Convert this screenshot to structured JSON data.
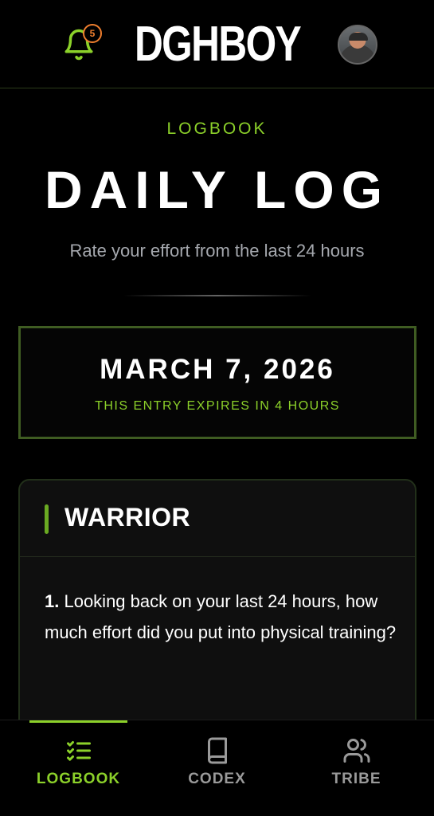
{
  "header": {
    "logo_text": "DGHBOY",
    "notification_count": "5",
    "icons": {
      "notifications": "bell-icon",
      "profile": "avatar"
    }
  },
  "hero": {
    "eyebrow": "LOGBOOK",
    "title": "DAILY LOG",
    "subtitle": "Rate your effort from the last 24 hours"
  },
  "entry": {
    "date": "MARCH 7, 2026",
    "expiry": "THIS ENTRY EXPIRES IN 4 HOURS"
  },
  "section": {
    "title": "WARRIOR",
    "question_number": "1.",
    "question_text": " Looking back on your last 24 hours, how much effort did you put into physical training?"
  },
  "nav": {
    "items": [
      {
        "label": "LOGBOOK",
        "icon": "checklist-icon",
        "active": true
      },
      {
        "label": "CODEX",
        "icon": "book-icon",
        "active": false
      },
      {
        "label": "TRIBE",
        "icon": "users-icon",
        "active": false
      }
    ]
  },
  "colors": {
    "accent": "#8cd12a",
    "badge": "#f07f2e",
    "background": "#000000",
    "muted_text": "#a5a8ae"
  }
}
